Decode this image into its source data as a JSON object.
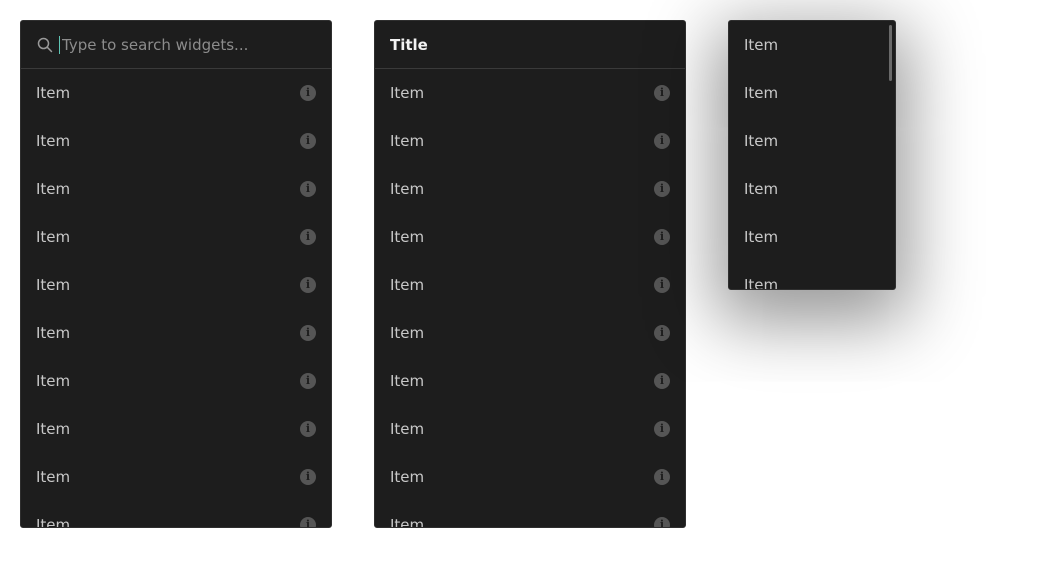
{
  "search_panel": {
    "placeholder": "Type to search widgets...",
    "items": [
      "Item",
      "Item",
      "Item",
      "Item",
      "Item",
      "Item",
      "Item",
      "Item",
      "Item",
      "Item"
    ]
  },
  "title_panel": {
    "title": "Title",
    "items": [
      "Item",
      "Item",
      "Item",
      "Item",
      "Item",
      "Item",
      "Item",
      "Item",
      "Item",
      "Item"
    ]
  },
  "compact_panel": {
    "items": [
      "Item",
      "Item",
      "Item",
      "Item",
      "Item",
      "Item"
    ]
  },
  "icons": {
    "search": "search-icon",
    "info": "info-icon"
  },
  "colors": {
    "panel_bg": "#1d1d1d",
    "caret_accent": "#5fc5b4",
    "text": "#c8c8c8",
    "info_icon": "#555555"
  }
}
